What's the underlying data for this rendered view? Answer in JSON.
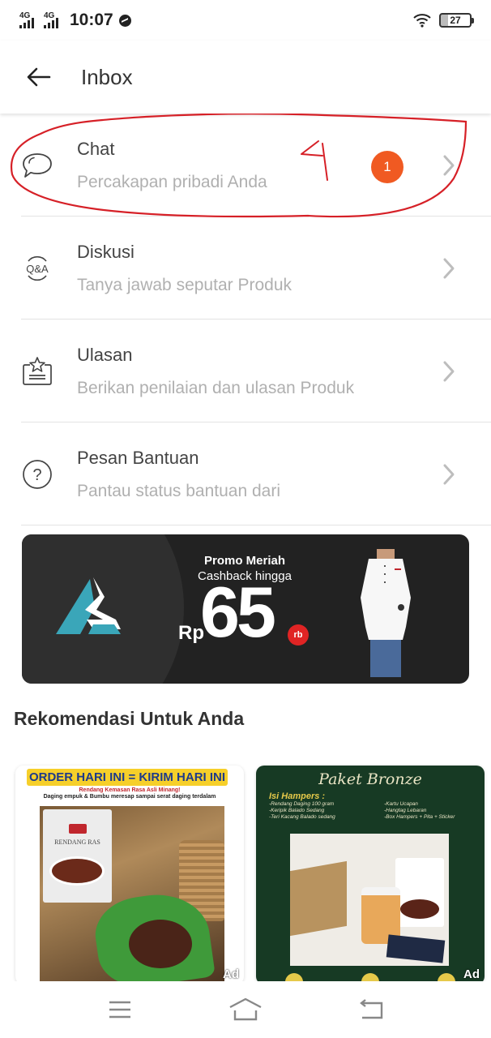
{
  "status_bar": {
    "signal_1": "4G",
    "signal_2": "4G",
    "time": "10:07",
    "notification_icon": "messenger-icon",
    "wifi_icon": "wifi-icon",
    "battery": "27"
  },
  "header": {
    "back_icon": "arrow-left-icon",
    "title": "Inbox"
  },
  "menu": [
    {
      "icon": "chat-bubble-icon",
      "title": "Chat",
      "subtitle": "Percakapan pribadi Anda",
      "badge": "1"
    },
    {
      "icon": "qa-icon",
      "icon_text": "Q&A",
      "title": "Diskusi",
      "subtitle": "Tanya jawab seputar Produk"
    },
    {
      "icon": "review-star-icon",
      "title": "Ulasan",
      "subtitle": "Berikan penilaian dan ulasan Produk"
    },
    {
      "icon": "help-question-icon",
      "icon_text": "?",
      "title": "Pesan Bantuan",
      "subtitle": "Pantau status bantuan dari"
    }
  ],
  "annotation": {
    "text": "4",
    "color": "#d62027"
  },
  "promo": {
    "title": "Promo Meriah",
    "subtitle": "Cashback hingga",
    "currency": "Rp",
    "amount": "65",
    "unit": "rb"
  },
  "recommendations": {
    "title": "Rekomendasi Untuk Anda",
    "products": [
      {
        "banner": "ORDER HARI INI = KIRIM HARI INI",
        "line1": "Rendang Kemasan Rasa Asli Minang!",
        "line2": "Daging empuk & Bumbu meresap sampai serat daging terdalam",
        "brand": "RENDANG RAS",
        "ad_label": "Ad"
      },
      {
        "title": "Paket Bronze",
        "isi_label": "Isi Hampers :",
        "items_left": [
          "-Rendang Daging 100 gram",
          "-Keripik Balado Sedang",
          "-Teri Kacang Balado sedang"
        ],
        "items_right": [
          "-Kartu Ucapan",
          "-Hangtag Lebaran",
          "-Box Hampers + Pita + Sticker"
        ],
        "ad_label": "Ad"
      }
    ]
  },
  "nav_bar": {
    "menu_icon": "menu-icon",
    "home_icon": "home-icon",
    "back_icon": "back-icon"
  },
  "colors": {
    "badge": "#f05a22",
    "annotation": "#d62027",
    "promo_bg": "#222222",
    "promo_logo": "#3aa6b9",
    "rb_badge": "#e02424"
  }
}
